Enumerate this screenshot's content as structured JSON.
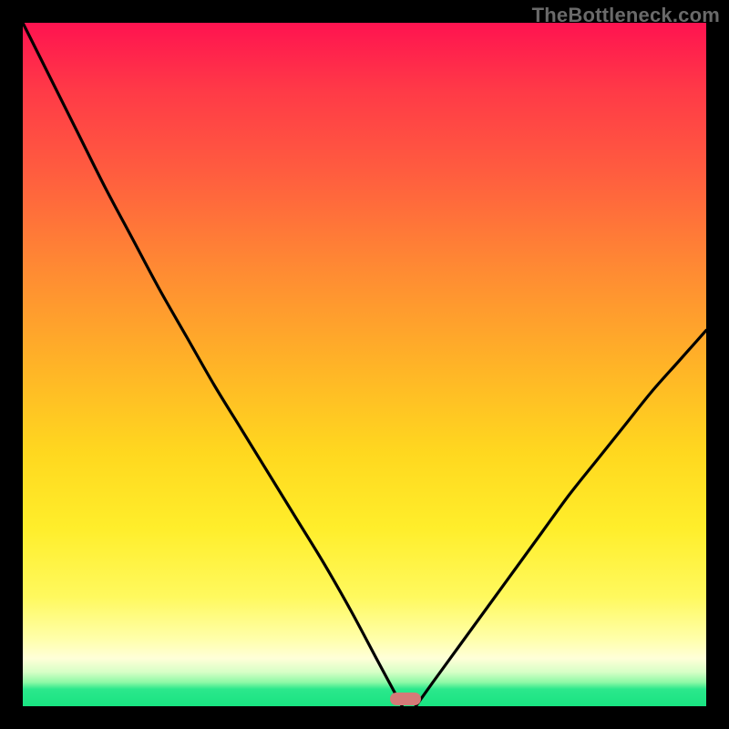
{
  "watermark": {
    "text": "TheBottleneck.com"
  },
  "colors": {
    "background": "#000000",
    "gradient_top": "#ff1350",
    "gradient_mid": "#ffd81f",
    "gradient_bottom": "#18e381",
    "curve_stroke": "#000000",
    "floor_marker": "#d57a78",
    "watermark": "#6a6a6a"
  },
  "chart_data": {
    "type": "line",
    "title": "",
    "xlabel": "",
    "ylabel": "",
    "xlim": [
      0,
      100
    ],
    "ylim": [
      0,
      100
    ],
    "grid": false,
    "legend": false,
    "annotations": [
      {
        "name": "watermark",
        "text": "TheBottleneck.com",
        "position": "top-right"
      },
      {
        "name": "floor-marker",
        "color": "#d57a78",
        "x": 56,
        "y": 0
      }
    ],
    "series": [
      {
        "name": "left-branch",
        "x": [
          0,
          4,
          8,
          12,
          16,
          20,
          24,
          28,
          32,
          36,
          40,
          44,
          48,
          52,
          55.5
        ],
        "values": [
          100,
          92,
          84,
          76,
          68.5,
          61,
          54,
          47,
          40.5,
          34,
          27.5,
          21,
          14,
          6.5,
          0
        ]
      },
      {
        "name": "right-branch",
        "x": [
          57.5,
          60,
          64,
          68,
          72,
          76,
          80,
          84,
          88,
          92,
          96,
          100
        ],
        "values": [
          0,
          3.5,
          9,
          14.5,
          20,
          25.5,
          31,
          36,
          41,
          46,
          50.5,
          55
        ]
      }
    ]
  }
}
